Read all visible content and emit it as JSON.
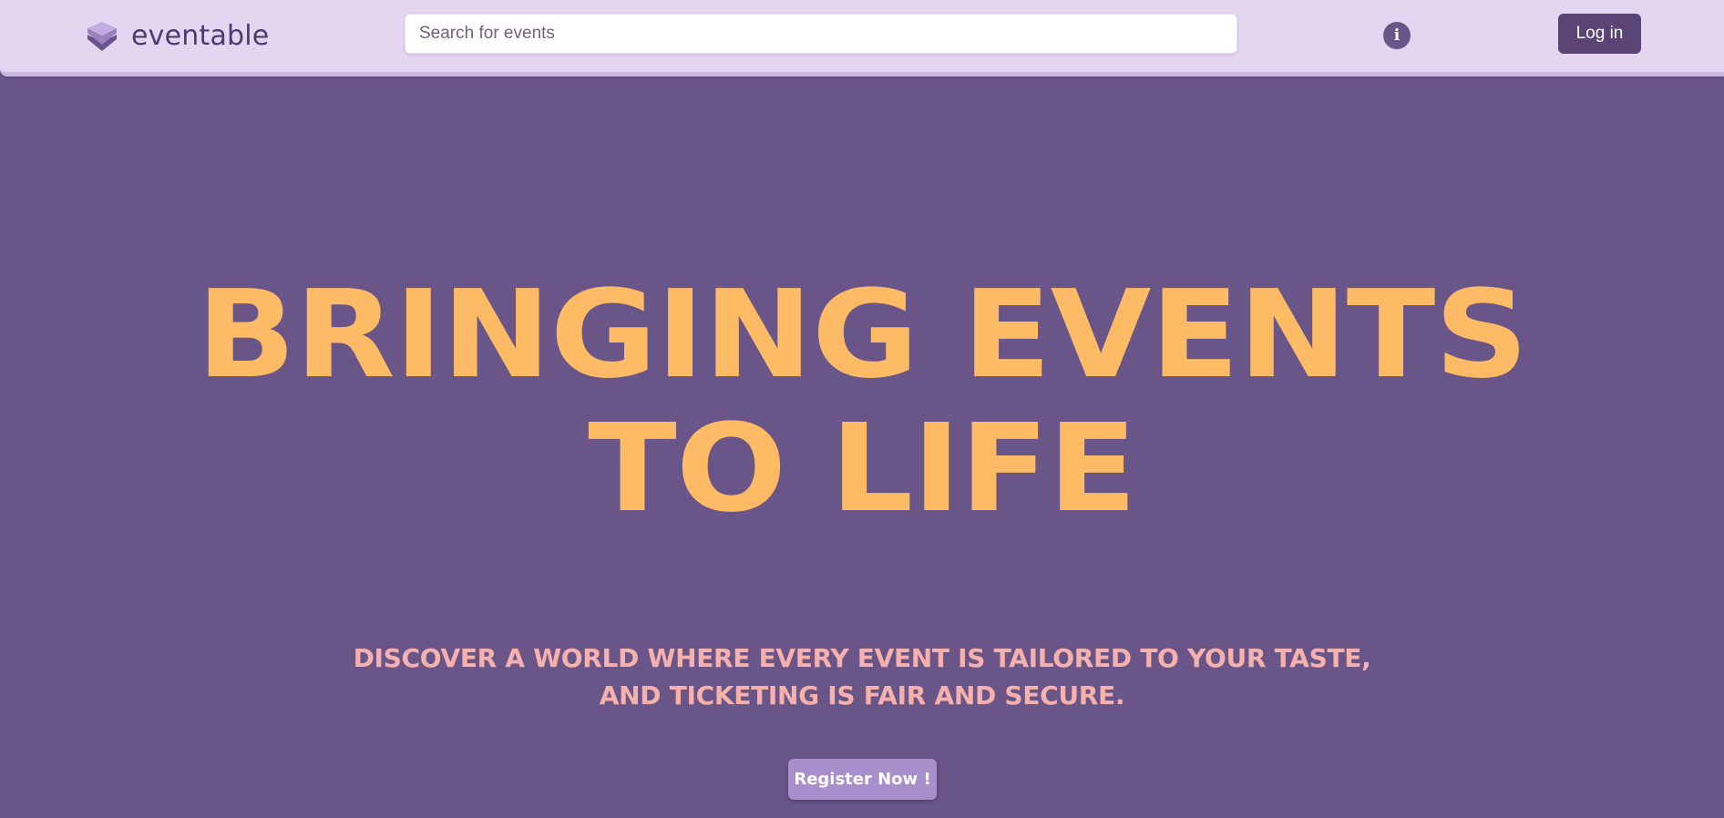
{
  "header": {
    "brand_name": "eventable",
    "search_placeholder": "Search for events",
    "info_glyph": "i",
    "login_label": "Log in"
  },
  "hero": {
    "headline_line1": "Bringing Events",
    "headline_line2": "to Life",
    "subline_line1": "Discover a world where every event is tailored to your taste,",
    "subline_line2": "and ticketing is fair and secure.",
    "register_label": "Register Now !"
  },
  "icons": {
    "logo": "layers-icon",
    "info": "info-icon"
  },
  "colors": {
    "header_bg": "#e4d6f1",
    "hero_bg": "#6a5589",
    "headline": "#fdbb66",
    "subline": "#f7b1ad",
    "login_button": "#5a4476",
    "register_button": "#a88fcb",
    "brand_text": "#4e3a6e"
  }
}
